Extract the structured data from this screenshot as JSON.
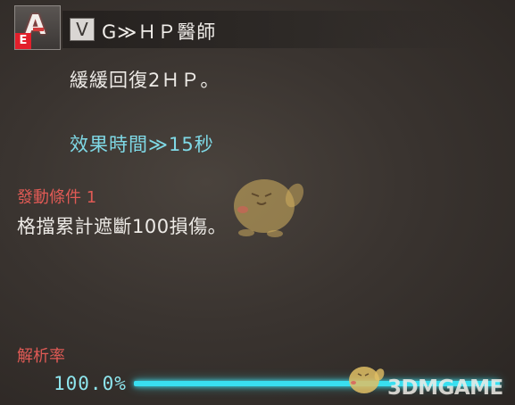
{
  "skill": {
    "icon_letter": "A",
    "rank": "E",
    "type_badge": "V",
    "name": "G≫ＨＰ醫師"
  },
  "description": "緩緩回復2ＨＰ。",
  "duration": "效果時間≫15秒",
  "condition": {
    "label": "發動條件 1",
    "text": "格擋累計遮斷100損傷。"
  },
  "analysis": {
    "label": "解析率",
    "value_text": "100.0%",
    "progress": 1.0
  },
  "watermark": {
    "text": "3DMGAME"
  },
  "colors": {
    "accent_cyan": "#39dff0",
    "label_red": "#e05a55",
    "rank_red": "#e21f2b"
  },
  "icons": {
    "skill_icon": "a-skill-icon",
    "mascot": "duck-mascot-icon"
  }
}
